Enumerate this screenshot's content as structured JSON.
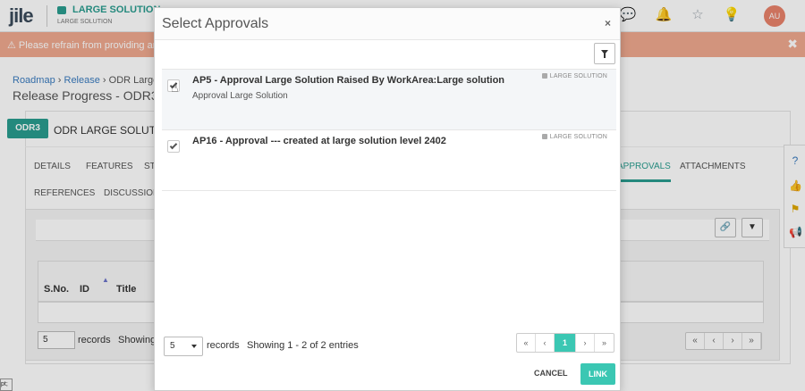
{
  "app": {
    "logo": "jile",
    "workspace_title": "LARGE SOLUTION",
    "workspace_subtitle": "LARGE SOLUTION",
    "avatar_initials": "AU"
  },
  "warning": {
    "text": "⚠ Please refrain from providing any",
    "close": "✖"
  },
  "breadcrumb": {
    "item1": "Roadmap",
    "sep": "›",
    "item2": "Release",
    "item3": "ODR Large"
  },
  "page": {
    "title": "Release Progress - ODR3",
    "tag": "ODR3",
    "odr_title": "ODR LARGE SOLUTION"
  },
  "tabs": {
    "details": "DETAILS",
    "features": "FEATURES",
    "st": "ST",
    "approvals": "APPROVALS",
    "attachments": "ATTACHMENTS",
    "references": "REFERENCES",
    "discussion": "DISCUSSION"
  },
  "bg_table": {
    "col_sno": "S.No.",
    "col_id": "ID",
    "col_title": "Title",
    "page_size": "5",
    "records": "records",
    "showing": "Showing",
    "pager": [
      "«",
      "‹",
      "›",
      "»"
    ]
  },
  "status_chip": "pt;",
  "modal": {
    "title": "Select Approvals",
    "close": "×",
    "items": [
      {
        "title": "AP5 - Approval Large Solution Raised By WorkArea:Large solution",
        "subtitle": "Approval Large Solution",
        "tag": "LARGE SOLUTION",
        "checked": true
      },
      {
        "title": "AP16 - Approval --- created at large solution level 2402",
        "subtitle": "",
        "tag": "LARGE SOLUTION",
        "checked": true
      }
    ],
    "page_size": "5",
    "records_label": "records",
    "entries_label": "Showing 1 - 2 of 2 entries",
    "pager": {
      "first": "«",
      "prev": "‹",
      "current": "1",
      "next": "›",
      "last": "»"
    },
    "cancel_label": "CANCEL",
    "link_label": "LINK"
  },
  "colors": {
    "accent": "#3bc7b3",
    "brand": "#2a9d8f",
    "warning": "#f0a98f"
  }
}
